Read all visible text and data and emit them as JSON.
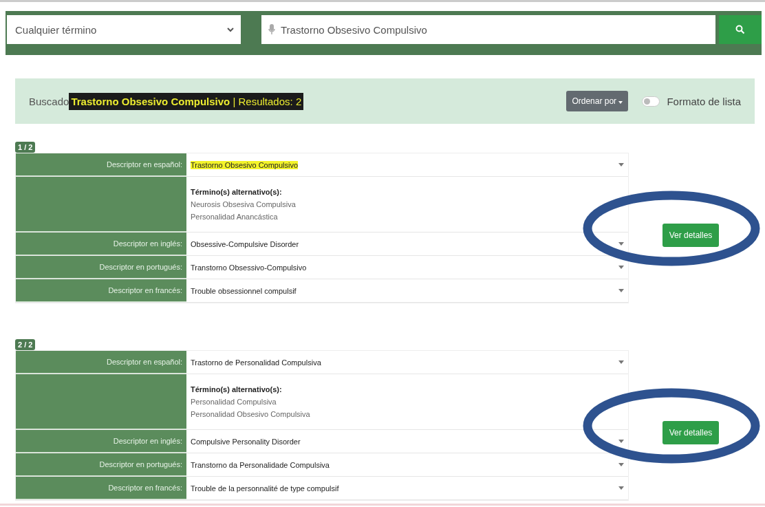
{
  "search_bar": {
    "scope_select": "Cualquier término",
    "query": "Trastorno Obsesivo Compulsivo"
  },
  "summary": {
    "label": "Buscado",
    "highlight": "**Trastorno Obsesivo Compulsivo** | Resultados: 2",
    "sort_button": "Ordenar por",
    "list_toggle": {
      "label": "Formato de lista",
      "on": false
    }
  },
  "results": [
    {
      "badge": "1 / 2",
      "circled": true,
      "button": "Ver detalles",
      "rows": [
        {
          "kind": "descriptor",
          "label": "Descriptor en español:",
          "value": "Trastorno Obsesivo Compulsivo",
          "highlighted": true
        },
        {
          "kind": "alternatives",
          "title": "Término(s) alternativo(s):",
          "terms": [
            "Neurosis Obsesiva Compulsiva",
            "Personalidad Anancástica"
          ]
        },
        {
          "kind": "descriptor",
          "label": "Descriptor en inglés:",
          "value": "Obsessive-Compulsive Disorder",
          "highlighted": false
        },
        {
          "kind": "descriptor",
          "label": "Descriptor en portugués:",
          "value": "Transtorno Obsessivo-Compulsivo",
          "highlighted": false
        },
        {
          "kind": "descriptor",
          "label": "Descriptor en francés:",
          "value": "Trouble obsessionnel compulsif",
          "highlighted": false
        }
      ]
    },
    {
      "badge": "2 / 2",
      "circled": true,
      "button": "Ver detalles",
      "rows": [
        {
          "kind": "descriptor",
          "label": "Descriptor en español:",
          "value": "Trastorno de Personalidad Compulsiva",
          "highlighted": false
        },
        {
          "kind": "alternatives",
          "title": "Término(s) alternativo(s):",
          "terms": [
            "Personalidad Compulsiva",
            "Personalidad Obsesivo Compulsiva"
          ]
        },
        {
          "kind": "descriptor",
          "label": "Descriptor en inglés:",
          "value": "Compulsive Personality Disorder",
          "highlighted": false
        },
        {
          "kind": "descriptor",
          "label": "Descriptor en portugués:",
          "value": "Transtorno da Personalidade Compulsiva",
          "highlighted": false
        },
        {
          "kind": "descriptor",
          "label": "Descriptor en francés:",
          "value": "Trouble de la personnalité de type compulsif",
          "highlighted": false
        }
      ]
    }
  ]
}
